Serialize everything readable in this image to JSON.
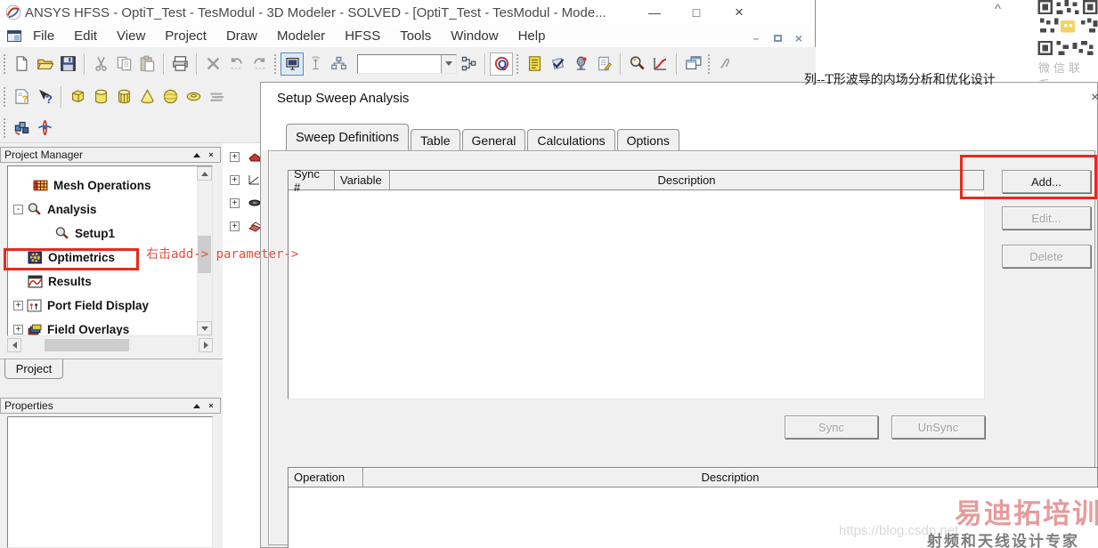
{
  "app": {
    "titlebar": {
      "title": "ANSYS HFSS - OptiT_Test - TesModul - 3D Modeler - SOLVED - [OptiT_Test - TesModul - Mode...",
      "minimize": "—",
      "maximize": "□",
      "close": "×"
    },
    "menubar": {
      "items": [
        "File",
        "Edit",
        "View",
        "Project",
        "Draw",
        "Modeler",
        "HFSS",
        "Tools",
        "Window",
        "Help"
      ],
      "mdi_minimize": "–",
      "mdi_close": "×"
    },
    "toolbar": {
      "combobox_value": "",
      "row1_icons": [
        "new-file",
        "open-folder",
        "save",
        "cut",
        "copy",
        "paste",
        "print",
        "delete",
        "undo",
        "redo",
        "solve-monitor",
        "remote-analysis",
        "network-analysis",
        "material-combobox",
        "connection-tree",
        "q-solver",
        "datasets-doc",
        "validate-check",
        "analyze",
        "edit-notes",
        "zoom-results",
        "report-curve",
        "cascade-windows",
        "pan-hand"
      ],
      "row2_icons": [
        "help-doc",
        "context-help",
        "draw-box",
        "draw-cylinder",
        "draw-polyhedron",
        "draw-cone",
        "draw-sphere",
        "draw-torus",
        "draw-polyline"
      ],
      "row3_icons": [
        "boundaries",
        "validate-rocket"
      ]
    }
  },
  "project_manager": {
    "title": "Project Manager",
    "tree": [
      {
        "label": "Mesh Operations",
        "icon": "mesh-grid-icon"
      },
      {
        "label": "Analysis",
        "icon": "magnifier-icon",
        "expander": "-"
      },
      {
        "label": "Setup1",
        "icon": "magnifier-icon"
      },
      {
        "label": "Optimetrics",
        "icon": "gear-icon",
        "highlighted": true
      },
      {
        "label": "Results",
        "icon": "chart-icon"
      },
      {
        "label": "Port Field Display",
        "icon": "port-field-icon",
        "expander": "+"
      },
      {
        "label": "Field Overlays",
        "icon": "layers-icon",
        "expander": "+"
      }
    ],
    "tab": "Project"
  },
  "properties_panel": {
    "title": "Properties"
  },
  "dialog": {
    "title": "Setup Sweep Analysis",
    "close": "×",
    "tabs": [
      "Sweep Definitions",
      "Table",
      "General",
      "Calculations",
      "Options"
    ],
    "active_tab": "Sweep Definitions",
    "sweep_table": {
      "headers": [
        "Sync #",
        "Variable",
        "Description"
      ],
      "rows": []
    },
    "buttons": {
      "add": "Add...",
      "edit": "Edit...",
      "delete": "Delete",
      "sync": "Sync",
      "unsync": "UnSync"
    },
    "operation_table": {
      "headers": [
        "Operation",
        "Description"
      ],
      "rows": []
    }
  },
  "annotations": {
    "top": "列--T形波导的内场分析和优化设计",
    "red": "右击add-> parameter->"
  },
  "qr": {
    "label": "微信联系"
  },
  "watermark": {
    "url": "https://blog.csdn.net",
    "brand": "易迪拓培训",
    "slogan": "射频和天线设计专家"
  },
  "glyphs": {
    "plus": "+",
    "minus": "-",
    "caret": "^"
  },
  "colors": {
    "highlight_red": "#e8291c",
    "titlebar_bg": "#ffffff",
    "chrome_bg": "#f0f0f0"
  }
}
